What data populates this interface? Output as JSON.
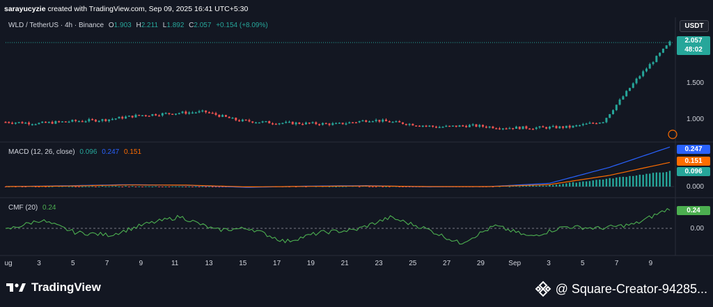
{
  "header": {
    "author": "sarayucyzie",
    "text": "created with TradingView.com, Sep 09, 2025 16:41 UTC+5:30"
  },
  "symbol": {
    "name": "WLD / TetherUS · 4h · Binance",
    "o_label": "O",
    "o": "1.903",
    "h_label": "H",
    "h": "2.211",
    "l_label": "L",
    "l": "1.892",
    "c_label": "C",
    "c": "2.057",
    "change": "+0.154 (+8.09%)",
    "currency": "USDT",
    "last_price": "2.057",
    "countdown": "48:02"
  },
  "macd": {
    "label": "MACD (12, 26, close)",
    "macd": "0.096",
    "signal": "0.247",
    "hist": "0.151",
    "tags": [
      "0.247",
      "0.151",
      "0.096"
    ],
    "zero": "0.000"
  },
  "cmf": {
    "label": "CMF (20)",
    "value": "0.24",
    "tag": "0.24",
    "zero": "0.00"
  },
  "colors": {
    "up": "#26a69a",
    "down": "#ef5350",
    "macd": "#2962ff",
    "signal": "#ff6d00",
    "cmf": "#4caf50",
    "bg": "#131722"
  },
  "footer": {
    "brand": "TradingView",
    "credit": "@ Square-Creator-94285..."
  },
  "chart_data": [
    {
      "type": "line",
      "title": "WLD / TetherUS · 4h · Binance",
      "x_ticks": [
        "ug",
        "3",
        "5",
        "7",
        "9",
        "11",
        "13",
        "15",
        "17",
        "19",
        "21",
        "23",
        "25",
        "27",
        "29",
        "Sep",
        "3",
        "5",
        "7",
        "9"
      ],
      "y_ticks": [
        "1.000",
        "1.500",
        "2.057"
      ],
      "x": [
        "Aug 1",
        "Aug 3",
        "Aug 5",
        "Aug 7",
        "Aug 9",
        "Aug 11",
        "Aug 13",
        "Aug 15",
        "Aug 17",
        "Aug 19",
        "Aug 21",
        "Aug 23",
        "Aug 25",
        "Aug 27",
        "Aug 29",
        "Sep 1",
        "Sep 3",
        "Sep 5",
        "Sep 7",
        "Sep 8",
        "Sep 9"
      ],
      "series": [
        {
          "values": [
            0.96,
            0.94,
            0.97,
            0.99,
            1.05,
            1.08,
            1.1,
            0.98,
            0.95,
            0.94,
            0.93,
            0.99,
            0.94,
            0.89,
            0.91,
            0.88,
            0.88,
            0.89,
            0.97,
            1.55,
            2.057
          ]
        }
      ]
    },
    {
      "type": "line",
      "title": "MACD (12, 26, close)",
      "x": [
        "Aug 1",
        "Aug 5",
        "Aug 9",
        "Aug 13",
        "Aug 17",
        "Aug 21",
        "Aug 25",
        "Aug 29",
        "Sep 3",
        "Sep 7",
        "Sep 8",
        "Sep 9"
      ],
      "series": [
        {
          "name": "MACD",
          "values": [
            0.0,
            0.005,
            0.012,
            0.008,
            -0.005,
            0.003,
            0.006,
            -0.002,
            0.0,
            0.02,
            0.12,
            0.247
          ]
        },
        {
          "name": "Signal",
          "values": [
            0.0,
            0.003,
            0.01,
            0.009,
            -0.002,
            0.001,
            0.004,
            0.0,
            0.0,
            0.012,
            0.07,
            0.151
          ]
        }
      ]
    },
    {
      "type": "line",
      "title": "CMF (20)",
      "x": [
        "Aug 1",
        "Aug 3",
        "Aug 5",
        "Aug 7",
        "Aug 9",
        "Aug 11",
        "Aug 13",
        "Aug 15",
        "Aug 17",
        "Aug 19",
        "Aug 21",
        "Aug 23",
        "Aug 25",
        "Aug 27",
        "Aug 29",
        "Sep 1",
        "Sep 3",
        "Sep 5",
        "Sep 7",
        "Sep 9"
      ],
      "series": [
        {
          "name": "CMF",
          "values": [
            -0.02,
            0.1,
            -0.05,
            -0.08,
            0.05,
            0.14,
            -0.02,
            0.0,
            -0.16,
            -0.05,
            -0.02,
            0.13,
            0.0,
            -0.18,
            0.03,
            -0.1,
            0.02,
            0.0,
            0.05,
            0.24
          ]
        }
      ]
    }
  ]
}
